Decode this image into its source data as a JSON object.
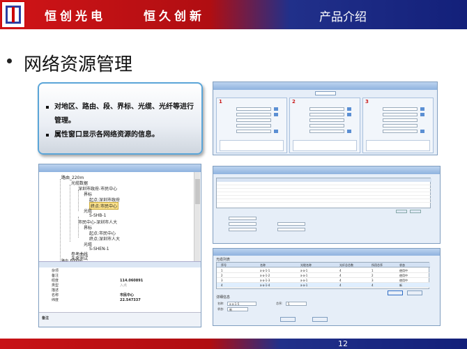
{
  "header": {
    "company": "恒创光电",
    "slogan": "恒久创新",
    "section_title": "产品介绍"
  },
  "page": {
    "title": "网络资源管理",
    "page_number": "12"
  },
  "callout": {
    "items": [
      "对地区、路由、段、界标、光缆、光纤等进行管理。",
      "属性窗口显示各网络资源的信息。"
    ]
  },
  "panels": [
    {
      "number": "1"
    },
    {
      "number": "2"
    },
    {
      "number": "3"
    }
  ],
  "tree": {
    "nodes": [
      "路由_220m",
      "光缆数据",
      "深圳市政府-市民中心",
      "界标",
      "起点:深圳市政府",
      "终点:市民中心",
      "光缆",
      "S-SHB-1",
      "市民中心-深圳市人大",
      "界标",
      "起点:市民中心",
      "终点:深圳市人大",
      "光缆",
      "S-SHEN-1",
      "参考曲线",
      "未来测试",
      "路由_6000m",
      "光缆数据"
    ]
  },
  "properties": {
    "rows": [
      {
        "key": "杂项",
        "value": ""
      },
      {
        "key": "备注",
        "value": ""
      },
      {
        "key": "经度",
        "value": "114.060891"
      },
      {
        "key": "类型",
        "value": "入点"
      },
      {
        "key": "描述",
        "value": ""
      },
      {
        "key": "名称",
        "value": "市民中心"
      },
      {
        "key": "纬度",
        "value": "22.547337"
      }
    ],
    "note_label": "备注"
  },
  "cable_window": {
    "title": "光缆列表",
    "columns": [
      "序号",
      "名称",
      "光缆名称",
      "光纤总芯数",
      "所用芯序",
      "状态"
    ],
    "rows": [
      [
        "1",
        "a-a-1-1",
        "a-a-1",
        "4",
        "1",
        "使用中"
      ],
      [
        "2",
        "a-a-1-2",
        "a-a-1",
        "4",
        "2",
        "使用中"
      ],
      [
        "3",
        "a-a-1-3",
        "a-a-1",
        "4",
        "3",
        "使用中"
      ],
      [
        "4",
        "a-a-1-4",
        "a-a-1",
        "4",
        "4",
        "新"
      ]
    ],
    "detail_label": "详细信息",
    "detail": {
      "name_label": "名称:",
      "name_value": "a-a-1-5",
      "order_label": "芯序:",
      "order_value": "5",
      "status_label": "状态:",
      "status_value": "新"
    }
  }
}
